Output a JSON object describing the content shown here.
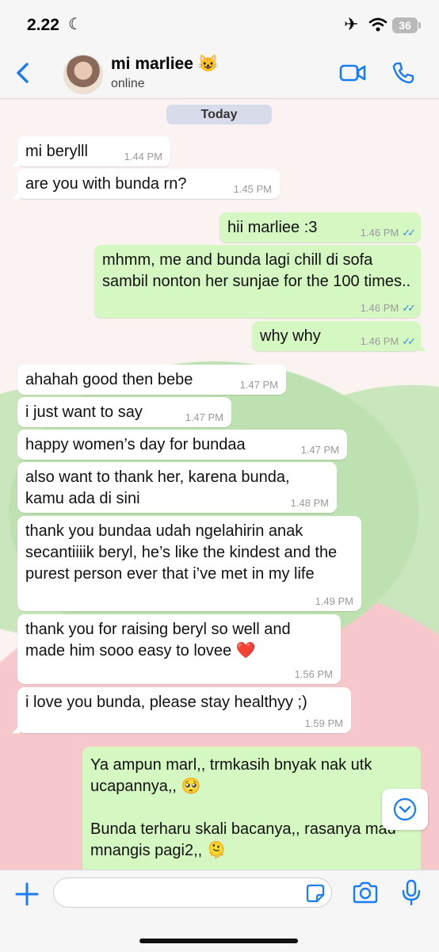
{
  "status_bar": {
    "time": "2.22",
    "battery": "36"
  },
  "header": {
    "contact_name": "mi marliee 😺",
    "presence": "online"
  },
  "chat": {
    "date_label": "Today",
    "messages": [
      {
        "dir": "in",
        "text": "mi berylll",
        "time": "1.44 PM"
      },
      {
        "dir": "in",
        "text": "are you with bunda rn?",
        "time": "1.45 PM"
      },
      {
        "dir": "out",
        "text": "hii marliee :3",
        "time": "1.46 PM"
      },
      {
        "dir": "out",
        "text": "mhmm, me and bunda lagi chill di sofa sambil nonton her sunjae for the 100 times..",
        "time": "1.46 PM"
      },
      {
        "dir": "out",
        "text": "why why",
        "time": "1.46 PM"
      },
      {
        "dir": "in",
        "text": "ahahah good then bebe",
        "time": "1.47 PM"
      },
      {
        "dir": "in",
        "text": "i just want to say",
        "time": "1.47 PM"
      },
      {
        "dir": "in",
        "text": "happy women’s day for bundaa",
        "time": "1.47 PM"
      },
      {
        "dir": "in",
        "text": "also want to thank her, karena bunda, kamu ada di sini",
        "time": "1.48 PM"
      },
      {
        "dir": "in",
        "text": "thank you bundaa udah ngelahirin anak secantiiiik beryl, he’s like the kindest and the purest person ever that i’ve met in my life",
        "time": "1.49 PM"
      },
      {
        "dir": "in",
        "text": "thank you for raising beryl so well and made him sooo easy to lovee ❤️",
        "time": "1.56 PM"
      },
      {
        "dir": "in",
        "text": "i love you bunda, please stay healthyy ;)",
        "time": "1.59 PM"
      },
      {
        "dir": "out",
        "text": "Ya ampun marl,, trmkasih bnyak nak utk ucapannya,, 🥺\n\nBunda terharu skali bacanya,, rasanya mau mnangis pagi2,, 🫠",
        "time": ""
      }
    ]
  },
  "input": {
    "placeholder": ""
  },
  "colors": {
    "accent": "#1a7cf5",
    "outgoing_bubble": "#d5f7c1",
    "incoming_bubble": "#ffffff",
    "read_ticks": "#3d8ce0"
  },
  "icons": [
    "back-chevron-icon",
    "video-call-icon",
    "voice-call-icon",
    "scroll-down-icon",
    "plus-icon",
    "sticker-icon",
    "camera-icon",
    "microphone-icon"
  ]
}
